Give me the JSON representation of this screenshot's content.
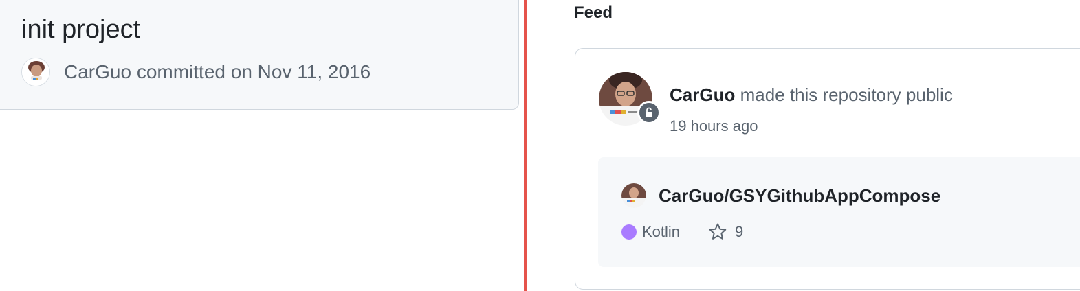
{
  "commit": {
    "title": "init project",
    "author": "CarGuo",
    "meta_suffix": "committed on Nov 11, 2016"
  },
  "feed": {
    "heading": "Feed",
    "event": {
      "actor": "CarGuo",
      "action": "made this repository public",
      "time": "19 hours ago",
      "badge_icon": "unlock-icon"
    },
    "repo": {
      "full_name": "CarGuo/GSYGithubAppCompose",
      "language": "Kotlin",
      "language_color": "#A97BFF",
      "stars": "9"
    }
  },
  "colors": {
    "divider": "#e5534b",
    "card_bg": "#f6f8fa",
    "border": "#d0d7de",
    "muted_text": "#59636e",
    "primary_text": "#1f2328"
  }
}
